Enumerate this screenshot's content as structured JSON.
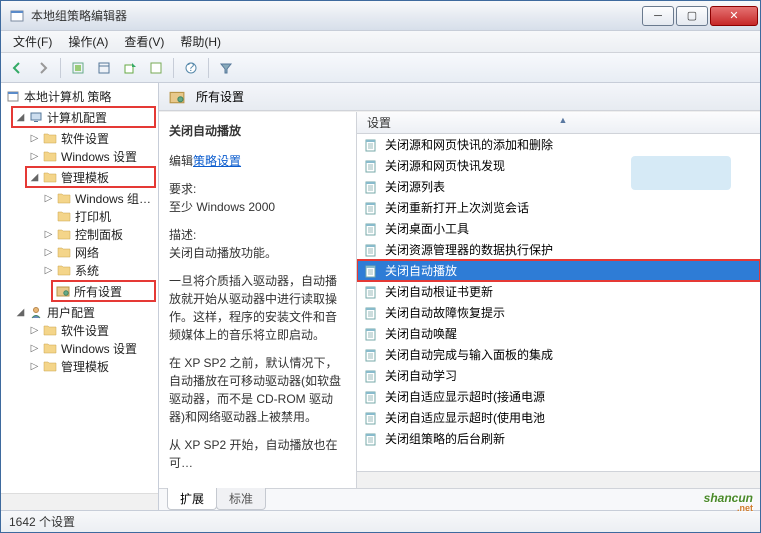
{
  "window": {
    "title": "本地组策略编辑器"
  },
  "menu": {
    "file": "文件(F)",
    "action": "操作(A)",
    "view": "查看(V)",
    "help": "帮助(H)"
  },
  "tree": {
    "root": "本地计算机 策略",
    "computer": "计算机配置",
    "software": "软件设置",
    "windows": "Windows 设置",
    "admin": "管理模板",
    "wincomp": "Windows 组…",
    "printer": "打印机",
    "ctrlpanel": "控制面板",
    "network": "网络",
    "system": "系统",
    "all": "所有设置",
    "user": "用户配置",
    "u_software": "软件设置",
    "u_windows": "Windows 设置",
    "u_admin": "管理模板"
  },
  "header": {
    "title": "所有设置"
  },
  "detail": {
    "title": "关闭自动播放",
    "edit_label": "编辑",
    "edit_link": "策略设置",
    "req_label": "要求:",
    "req_value": "至少 Windows 2000",
    "desc_label": "描述:",
    "desc_value": "关闭自动播放功能。",
    "body1": "一旦将介质插入驱动器，自动播放就开始从驱动器中进行读取操作。这样，程序的安装文件和音频媒体上的音乐将立即启动。",
    "body2": "在 XP SP2 之前，默认情况下，自动播放在可移动驱动器(如软盘驱动器，而不是 CD-ROM 驱动器)和网络驱动器上被禁用。",
    "body3": "从 XP SP2 开始，自动播放也在可…"
  },
  "column": {
    "setting": "设置"
  },
  "list": [
    "关闭源和网页快讯的添加和删除",
    "关闭源和网页快讯发现",
    "关闭源列表",
    "关闭重新打开上次浏览会话",
    "关闭桌面小工具",
    "关闭资源管理器的数据执行保护",
    "关闭自动播放",
    "关闭自动根证书更新",
    "关闭自动故障恢复提示",
    "关闭自动唤醒",
    "关闭自动完成与输入面板的集成",
    "关闭自动学习",
    "关闭自适应显示超时(接通电源",
    "关闭自适应显示超时(使用电池",
    "关闭组策略的后台刷新"
  ],
  "tabs": {
    "ext": "扩展",
    "std": "标准"
  },
  "status": {
    "text": "1642 个设置"
  },
  "watermark": {
    "main": "shancun",
    "sub": ".net"
  }
}
